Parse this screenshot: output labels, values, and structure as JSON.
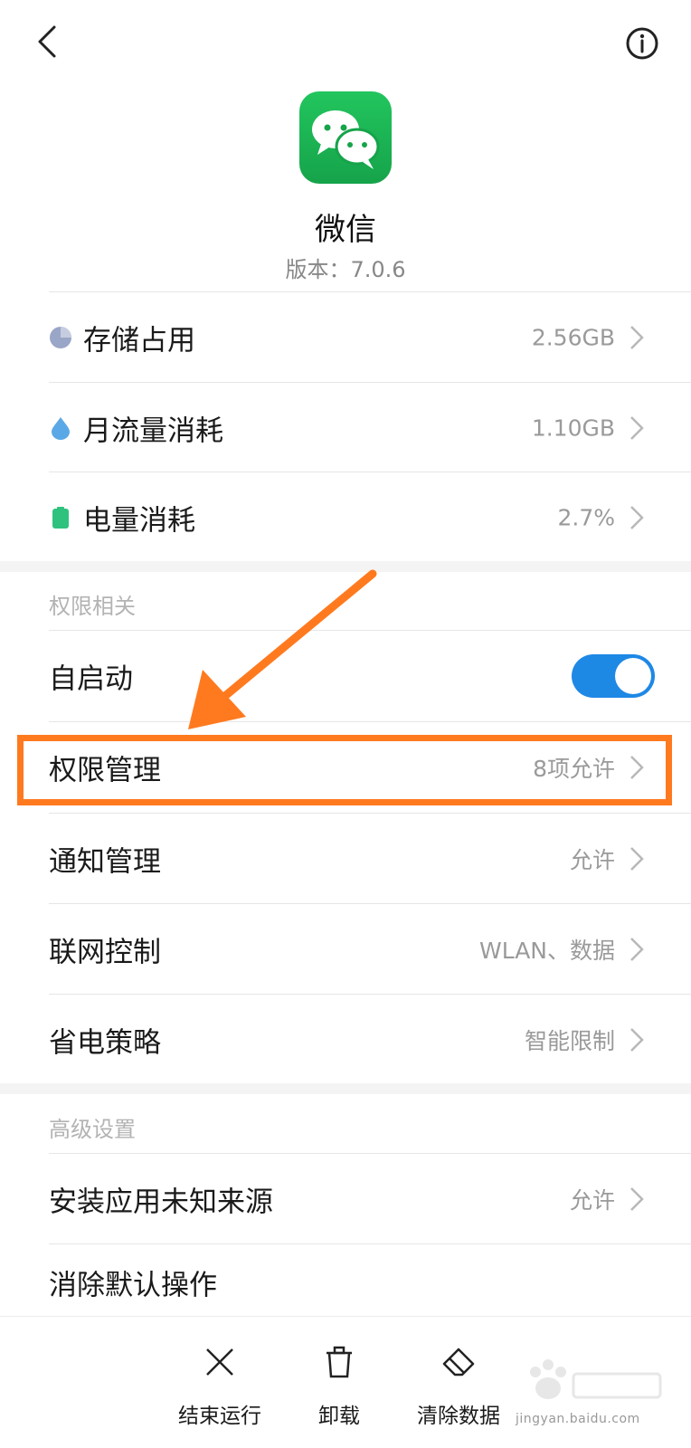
{
  "app": {
    "name": "微信",
    "version": "版本：7.0.6"
  },
  "usage": [
    {
      "label": "存储占用",
      "value": "2.56GB",
      "icon": "pie-chart-icon",
      "color": "#9aa6c7"
    },
    {
      "label": "月流量消耗",
      "value": "1.10GB",
      "icon": "water-drop-icon",
      "color": "#5ba8e6"
    },
    {
      "label": "电量消耗",
      "value": "2.7%",
      "icon": "battery-icon",
      "color": "#2ec27e"
    }
  ],
  "permissions_section": {
    "title": "权限相关",
    "autostart": {
      "label": "自启动",
      "on": true
    },
    "items": [
      {
        "label": "权限管理",
        "value": "8项允许"
      },
      {
        "label": "通知管理",
        "value": "允许"
      },
      {
        "label": "联网控制",
        "value": "WLAN、数据"
      },
      {
        "label": "省电策略",
        "value": "智能限制"
      }
    ]
  },
  "advanced_section": {
    "title": "高级设置",
    "items": [
      {
        "label": "安装应用未知来源",
        "value": "允许"
      },
      {
        "label": "消除默认操作",
        "value": ""
      }
    ]
  },
  "bottom_actions": [
    {
      "label": "结束运行",
      "icon": "close-icon"
    },
    {
      "label": "卸载",
      "icon": "trash-icon"
    },
    {
      "label": "清除数据",
      "icon": "eraser-icon"
    }
  ],
  "colors": {
    "accent": "#1e88e5",
    "highlight": "#ff7a1f",
    "wechat_green": "#1aad19"
  },
  "watermark": {
    "text": "jingyan.baidu.com"
  }
}
